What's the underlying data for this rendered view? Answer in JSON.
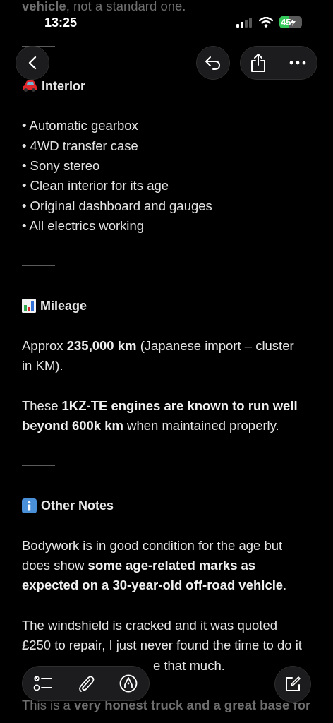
{
  "status_bar": {
    "time": "13:25",
    "battery": "45",
    "charging": true
  },
  "blocks": [
    {
      "kind": "faded",
      "text": "**vehicle**, not a standard one."
    },
    {
      "kind": "rule"
    },
    {
      "kind": "heading",
      "text": "Interior"
    },
    {
      "kind": "list",
      "items": [
        "• Automatic gearbox",
        "• 4WD transfer case",
        "• Sony stereo",
        "• Clean interior for its age",
        "• Original dashboard and gauges",
        "• All electrics working"
      ]
    },
    {
      "kind": "rule"
    },
    {
      "kind": "heading",
      "text": "Mileage"
    },
    {
      "kind": "paragraph",
      "text": "Approx **235,000 km** (Japanese import – cluster in KM)."
    },
    {
      "kind": "paragraph",
      "text": "These **1KZ-TE engines are known to run well beyond 600k km** when maintained properly."
    },
    {
      "kind": "rule"
    },
    {
      "kind": "heading",
      "text": "Other Notes"
    },
    {
      "kind": "paragraph",
      "text": "Bodywork is in good condition for the age but does show **some age-related marks as expected on a 30-year-old off-road vehicle**."
    },
    {
      "kind": "covered",
      "text": "The windshield is cracked and it was quoted £250 to repair, I just never found the time to do it",
      "tail": "e that much."
    },
    {
      "kind": "faded",
      "text": "This is a **very honest truck and a great base for**"
    }
  ]
}
